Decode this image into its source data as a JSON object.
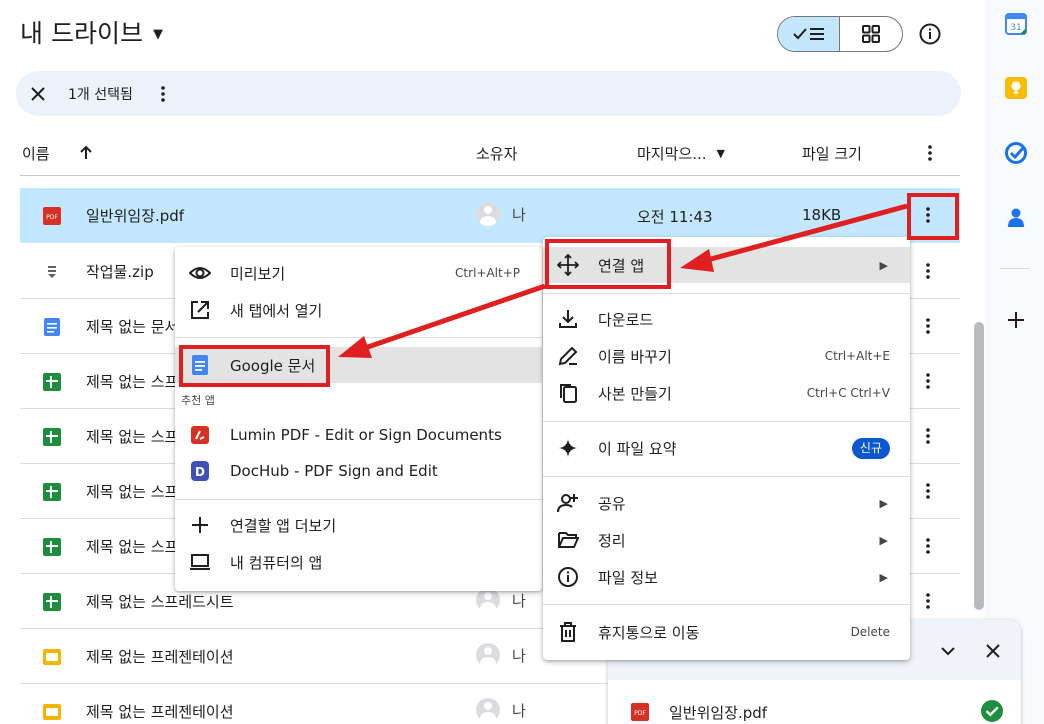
{
  "header": {
    "title": "내 드라이브",
    "info_label": "세부정보"
  },
  "selection_bar": {
    "text": "1개 선택됨"
  },
  "columns": {
    "name": "이름",
    "owner": "소유자",
    "modified": "마지막으...",
    "size": "파일 크기"
  },
  "rows": [
    {
      "name": "일반위임장.pdf",
      "type": "pdf",
      "owner": "나",
      "date": "오전 11:43",
      "size": "18KB"
    },
    {
      "name": "작업물.zip",
      "type": "zip"
    },
    {
      "name": "제목 없는 문서",
      "type": "doc"
    },
    {
      "name": "제목 없는 스프레드시트",
      "type": "sheet"
    },
    {
      "name": "제목 없는 스프레드시트",
      "type": "sheet"
    },
    {
      "name": "제목 없는 스프레드시트",
      "type": "sheet"
    },
    {
      "name": "제목 없는 스프레드시트",
      "type": "sheet"
    },
    {
      "name": "제목 없는 스프레드시트",
      "type": "sheet",
      "owner": "나"
    },
    {
      "name": "제목 없는 프레젠테이션",
      "type": "slides",
      "owner": "나"
    },
    {
      "name": "제목 없는 프레젠테이션",
      "type": "slides",
      "owner": "나"
    }
  ],
  "context_menu": {
    "open_with": "연결 앱",
    "download": "다운로드",
    "rename": "이름 바꾸기",
    "rename_shortcut": "Ctrl+Alt+E",
    "copy": "사본 만들기",
    "copy_shortcut": "Ctrl+C Ctrl+V",
    "summarize": "이 파일 요약",
    "new_badge": "신규",
    "share": "공유",
    "organize": "정리",
    "file_info": "파일 정보",
    "trash": "휴지통으로 이동",
    "trash_shortcut": "Delete"
  },
  "submenu": {
    "preview": "미리보기",
    "preview_shortcut": "Ctrl+Alt+P",
    "open_new_tab": "새 탭에서 열기",
    "google_docs": "Google 문서",
    "suggested_header": "추천 앱",
    "lumin": "Lumin PDF - Edit or Sign Documents",
    "dochub": "DocHub - PDF Sign and Edit",
    "more_apps": "연결할 앱 더보기",
    "computer_apps": "내 컴퓨터의 앱"
  },
  "toast": {
    "file": "일반위임장.pdf"
  },
  "colors": {
    "selected": "#c2e7ff",
    "annotation": "#e02020",
    "sheet": "#1e8e3e",
    "doc": "#4285f4",
    "slides": "#f4b400",
    "pdf": "#d93025"
  }
}
